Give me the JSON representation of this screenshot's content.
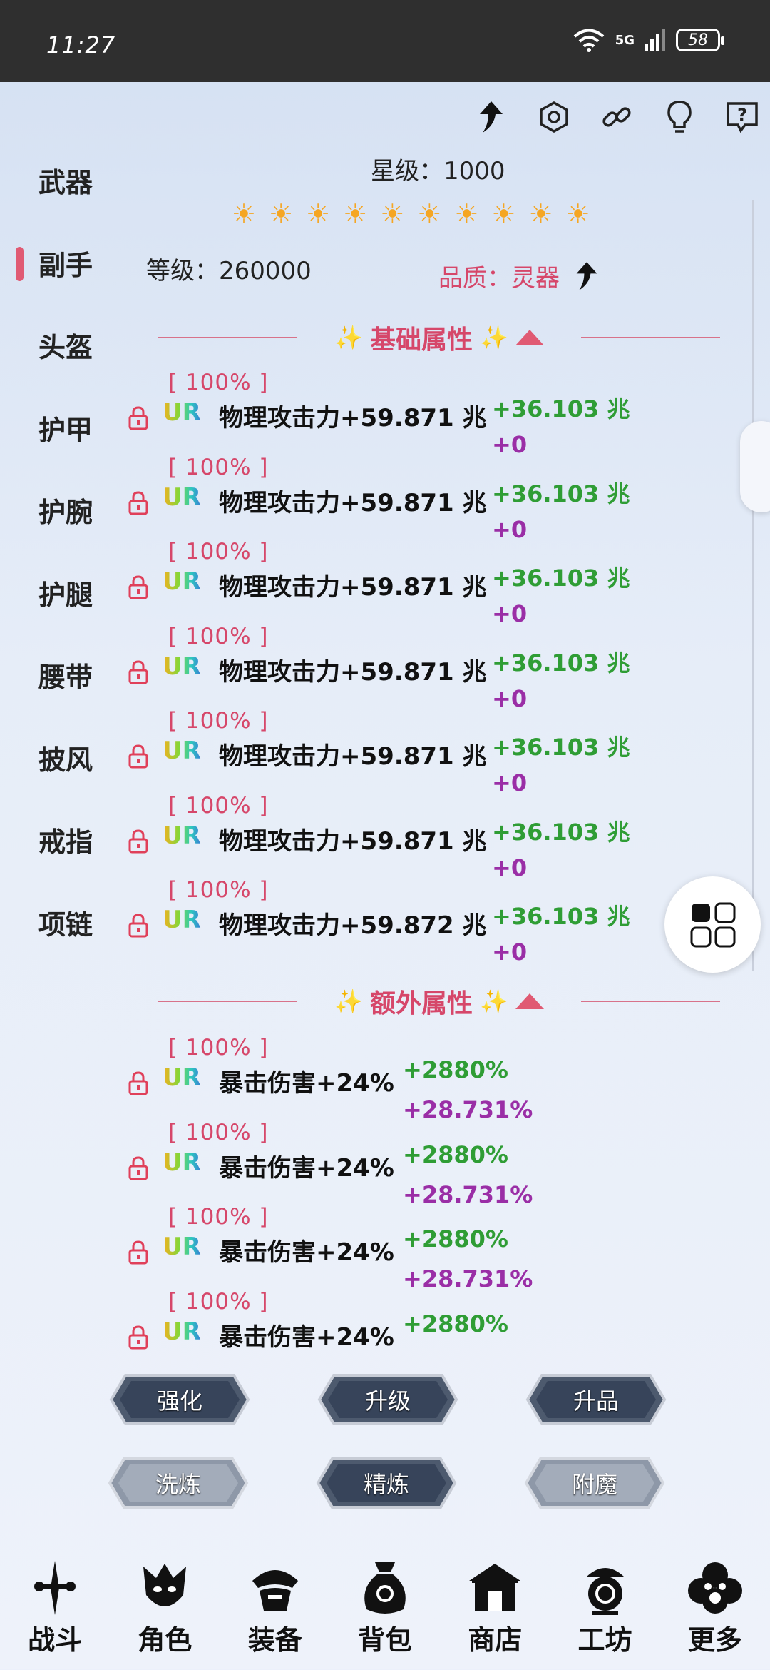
{
  "status_bar": {
    "time": "11:27",
    "network": "5G",
    "battery": "58"
  },
  "sidebar": {
    "items": [
      "武器",
      "副手",
      "头盔",
      "护甲",
      "护腕",
      "护腿",
      "腰带",
      "披风",
      "戒指",
      "项链"
    ],
    "active_index": 1
  },
  "header": {
    "star_label": "星级：1000",
    "level_label": "等级：260000",
    "quality_label": "品质：灵器",
    "sun_count": 10
  },
  "basic_section": {
    "title": "基础属性"
  },
  "basic_rows": [
    {
      "pct": "[ 100% ]",
      "grade": "UR",
      "prop": "物理攻击力+59.871 兆",
      "bonus1": "+36.103 兆",
      "bonus2": "+0"
    },
    {
      "pct": "[ 100% ]",
      "grade": "UR",
      "prop": "物理攻击力+59.871 兆",
      "bonus1": "+36.103 兆",
      "bonus2": "+0"
    },
    {
      "pct": "[ 100% ]",
      "grade": "UR",
      "prop": "物理攻击力+59.871 兆",
      "bonus1": "+36.103 兆",
      "bonus2": "+0"
    },
    {
      "pct": "[ 100% ]",
      "grade": "UR",
      "prop": "物理攻击力+59.871 兆",
      "bonus1": "+36.103 兆",
      "bonus2": "+0"
    },
    {
      "pct": "[ 100% ]",
      "grade": "UR",
      "prop": "物理攻击力+59.871 兆",
      "bonus1": "+36.103 兆",
      "bonus2": "+0"
    },
    {
      "pct": "[ 100% ]",
      "grade": "UR",
      "prop": "物理攻击力+59.871 兆",
      "bonus1": "+36.103 兆",
      "bonus2": "+0"
    },
    {
      "pct": "[ 100% ]",
      "grade": "UR",
      "prop": "物理攻击力+59.872 兆",
      "bonus1": "+36.103 兆",
      "bonus2": "+0"
    }
  ],
  "extra_section": {
    "title": "额外属性"
  },
  "extra_rows": [
    {
      "pct": "[ 100% ]",
      "grade": "UR",
      "prop": "暴击伤害+24%",
      "bonus1": "+2880%",
      "bonus2": "+28.731%"
    },
    {
      "pct": "[ 100% ]",
      "grade": "UR",
      "prop": "暴击伤害+24%",
      "bonus1": "+2880%",
      "bonus2": "+28.731%"
    },
    {
      "pct": "[ 100% ]",
      "grade": "UR",
      "prop": "暴击伤害+24%",
      "bonus1": "+2880%",
      "bonus2": "+28.731%"
    },
    {
      "pct": "[ 100% ]",
      "grade": "UR",
      "prop": "暴击伤害+24%",
      "bonus1": "+2880%",
      "bonus2": ""
    }
  ],
  "actions": {
    "strengthen": "强化",
    "upgrade": "升级",
    "upgrade_quality": "升品",
    "reroll": "洗炼",
    "refine": "精炼",
    "enchant": "附魔"
  },
  "bottom_nav": [
    "战斗",
    "角色",
    "装备",
    "背包",
    "商店",
    "工坊",
    "更多"
  ],
  "colors": {
    "accent": "#d6476a",
    "green": "#2f9d35",
    "purple": "#9a2ea6",
    "sun": "#f5a623"
  }
}
